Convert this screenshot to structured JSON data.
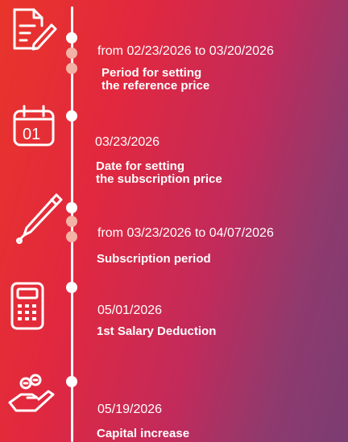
{
  "colors": {
    "gradient_start": "#e8352a",
    "gradient_end": "#7a3d72",
    "foreground": "#ffffff",
    "faded_dot": "#f2b2a5"
  },
  "timeline": [
    {
      "icon": "document-pen-icon",
      "date": "from 02/23/2026 to 03/20/2026",
      "label": "Period for setting\nthe reference price"
    },
    {
      "icon": "calendar-icon",
      "date": "03/23/2026",
      "label": "Date for setting\nthe subscription price"
    },
    {
      "icon": "pen-icon",
      "date": "from 03/23/2026 to 04/07/2026",
      "label": "Subscription period"
    },
    {
      "icon": "calculator-icon",
      "date": "05/01/2026",
      "label": "1st Salary Deduction"
    },
    {
      "icon": "hand-coins-icon",
      "date": "05/19/2026",
      "label": "Capital increase"
    }
  ],
  "calendar_day": "01"
}
